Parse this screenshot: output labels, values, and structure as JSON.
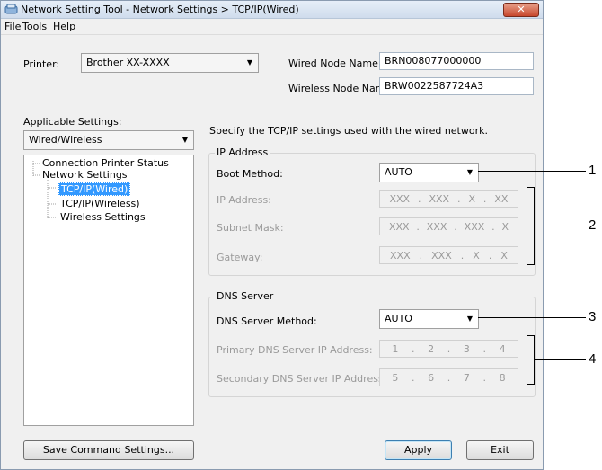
{
  "window": {
    "title": "Network Setting Tool - Network Settings > TCP/IP(Wired)",
    "close_label": "✕"
  },
  "menu": [
    "File",
    "Tools",
    "Help"
  ],
  "printer": {
    "label": "Printer:",
    "value": "Brother XX-XXXX"
  },
  "wired_node": {
    "label": "Wired Node Name:",
    "value": "BRN008077000000"
  },
  "wireless_node": {
    "label": "Wireless Node Name:",
    "value": "BRW0022587724A3"
  },
  "applicable": {
    "label": "Applicable Settings:",
    "value": "Wired/Wireless"
  },
  "tree": {
    "items": [
      "Connection Printer Status",
      "Network Settings",
      "TCP/IP(Wired)",
      "TCP/IP(Wireless)",
      "Wireless Settings"
    ]
  },
  "description": "Specify the TCP/IP settings used with the wired network.",
  "ip_group": {
    "title": "IP Address",
    "boot_label": "Boot Method:",
    "boot_value": "AUTO",
    "ip_label": "IP Address:",
    "ip_parts": [
      "XXX",
      ".",
      "XXX",
      ".",
      "X",
      ".",
      "XX"
    ],
    "subnet_label": "Subnet Mask:",
    "subnet_parts": [
      "XXX",
      ".",
      "XXX",
      ".",
      "XXX",
      ".",
      "X"
    ],
    "gateway_label": "Gateway:",
    "gateway_parts": [
      "XXX",
      ".",
      "XXX",
      ".",
      "X",
      ".",
      "X"
    ]
  },
  "dns_group": {
    "title": "DNS Server",
    "method_label": "DNS Server Method:",
    "method_value": "AUTO",
    "primary_label": "Primary DNS Server IP Address:",
    "primary_parts": [
      "1",
      ".",
      "2",
      ".",
      "3",
      ".",
      "4"
    ],
    "secondary_label": "Secondary DNS Server IP Address:",
    "secondary_parts": [
      "5",
      ".",
      "6",
      ".",
      "7",
      ".",
      "8"
    ]
  },
  "buttons": {
    "save": "Save Command Settings...",
    "apply": "Apply",
    "exit": "Exit"
  },
  "callouts": [
    "1",
    "2",
    "3",
    "4"
  ]
}
